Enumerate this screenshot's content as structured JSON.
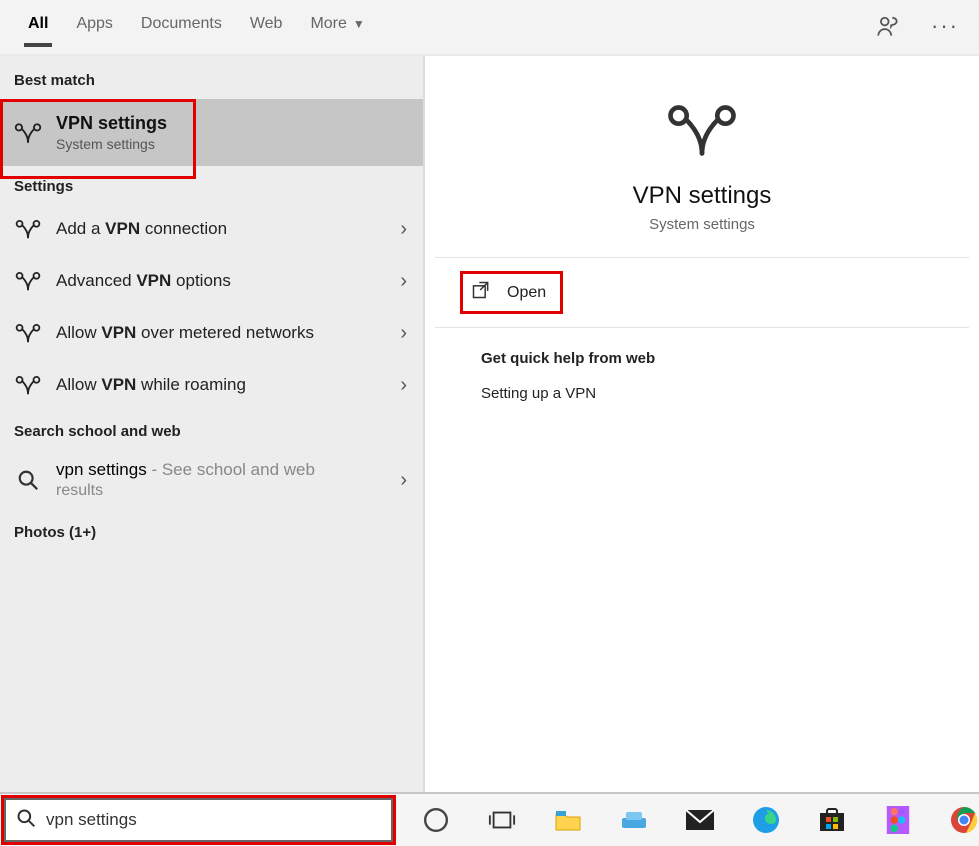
{
  "tabs": {
    "all": "All",
    "apps": "Apps",
    "documents": "Documents",
    "web": "Web",
    "more": "More"
  },
  "sections": {
    "best_match": "Best match",
    "settings": "Settings",
    "search_web": "Search school and web",
    "photos": "Photos (1+)"
  },
  "best_match": {
    "title": "VPN settings",
    "subtitle": "System settings"
  },
  "settings_items": [
    {
      "pre": "Add a ",
      "bold": "VPN",
      "post": " connection"
    },
    {
      "pre": "Advanced ",
      "bold": "VPN",
      "post": " options"
    },
    {
      "pre": "Allow ",
      "bold": "VPN",
      "post": " over metered networks"
    },
    {
      "pre": "Allow ",
      "bold": "VPN",
      "post": " while roaming"
    }
  ],
  "web_result": {
    "query": "vpn settings",
    "hint": " - See school and web",
    "hint2": "results"
  },
  "detail": {
    "title": "VPN settings",
    "subtitle": "System settings",
    "open": "Open",
    "help_title": "Get quick help from web",
    "help_link": "Setting up a VPN"
  },
  "search_input": {
    "value": "vpn settings"
  }
}
